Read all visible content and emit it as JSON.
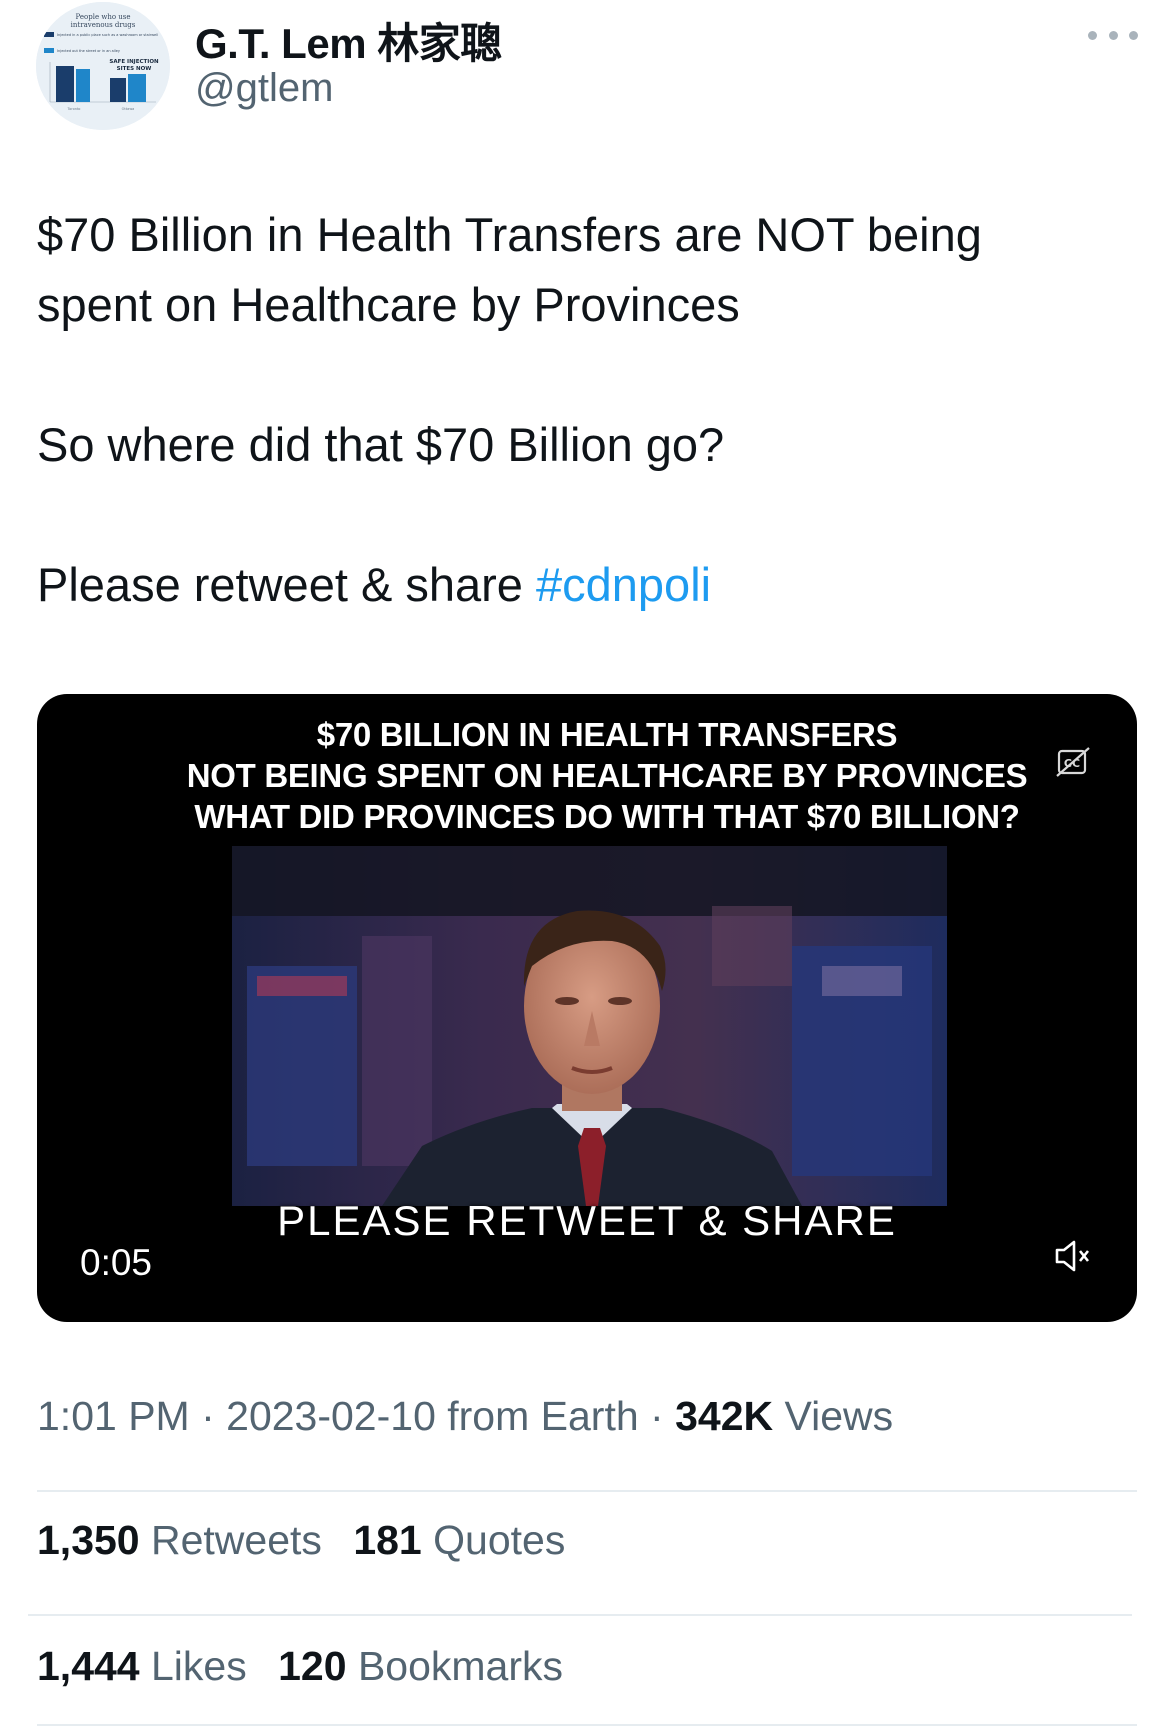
{
  "author": {
    "display_name": "G.T. Lem 林家聰",
    "handle": "@gtlem",
    "avatar": {
      "title_line1": "People who use",
      "title_line2": "intravenous drugs",
      "legend_1": "Injected in a public place such as a washroom or stairwell",
      "legend_2": "Injected out the street or in an alley",
      "badge_line1": "SAFE INJECTION",
      "badge_line2": "SITES NOW",
      "x_label_1": "Toronto",
      "x_label_2": "Ottawa"
    }
  },
  "more_icon": "ellipsis-icon",
  "tweet": {
    "line1": "$70 Billion in Health Transfers are NOT being",
    "line2": "spent on Healthcare by Provinces",
    "line3": "So where did that $70 Billion go?",
    "line4_prefix": "Please retweet & share ",
    "hashtag": "#cdnpoli",
    "hashtag_color": "#1d9bf0"
  },
  "video": {
    "caption_line1": "$70 BILLION IN HEALTH TRANSFERS",
    "caption_line2": "NOT BEING SPENT ON HEALTHCARE BY PROVINCES",
    "caption_line3": "WHAT DID PROVINCES DO WITH THAT $70 BILLION?",
    "subtitle": "PLEASE RETWEET & SHARE",
    "time": "0:05",
    "cc_icon": "closed-captions-icon",
    "mute_icon": "muted-speaker-icon"
  },
  "meta": {
    "time": "1:01 PM",
    "sep1": " · ",
    "date": "2023-02-10",
    "source": " from Earth",
    "sep2": " · ",
    "views_count": "342K",
    "views_label": " Views"
  },
  "stats": {
    "retweets_count": "1,350",
    "retweets_label": " Retweets",
    "quotes_count": "181",
    "quotes_label": " Quotes",
    "likes_count": "1,444",
    "likes_label": " Likes",
    "bookmarks_count": "120",
    "bookmarks_label": " Bookmarks"
  },
  "colors": {
    "text": "#0f1419",
    "secondary": "#536471",
    "link": "#1d9bf0",
    "divider": "#e6ecf0"
  }
}
